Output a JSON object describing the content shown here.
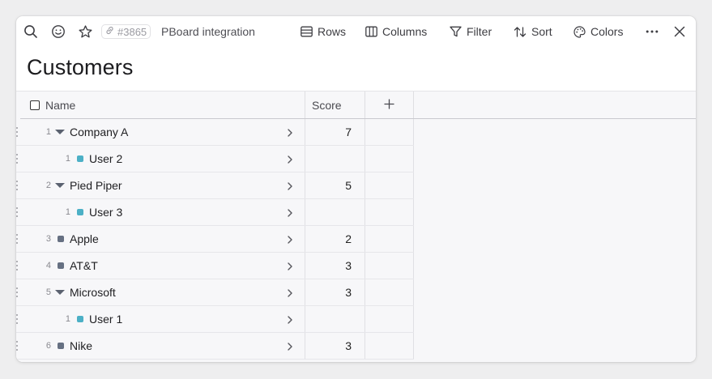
{
  "toolbar": {
    "icons": [
      "search-icon",
      "emoji-icon",
      "star-icon",
      "link-icon",
      "more-icon",
      "close-icon"
    ],
    "ref_id": "#3865",
    "ref_title": "PBoard integration",
    "rows_label": "Rows",
    "columns_label": "Columns",
    "filter_label": "Filter",
    "sort_label": "Sort",
    "colors_label": "Colors"
  },
  "page": {
    "title": "Customers"
  },
  "table": {
    "columns": {
      "name": "Name",
      "score": "Score",
      "add": "+"
    },
    "colors": {
      "group_marker": "#5b6270",
      "item_marker": "#667082",
      "child_marker": "#4cb0c6"
    },
    "rows": [
      {
        "num": "1",
        "label": "Company A",
        "score": "7",
        "level": 0,
        "kind": "group"
      },
      {
        "num": "1",
        "label": "User 2",
        "score": "",
        "level": 1,
        "kind": "child"
      },
      {
        "num": "2",
        "label": "Pied Piper",
        "score": "5",
        "level": 0,
        "kind": "group"
      },
      {
        "num": "1",
        "label": "User 3",
        "score": "",
        "level": 1,
        "kind": "child"
      },
      {
        "num": "3",
        "label": "Apple",
        "score": "2",
        "level": 0,
        "kind": "item"
      },
      {
        "num": "4",
        "label": "AT&T",
        "score": "3",
        "level": 0,
        "kind": "item"
      },
      {
        "num": "5",
        "label": "Microsoft",
        "score": "3",
        "level": 0,
        "kind": "group"
      },
      {
        "num": "1",
        "label": "User 1",
        "score": "",
        "level": 1,
        "kind": "child"
      },
      {
        "num": "6",
        "label": "Nike",
        "score": "3",
        "level": 0,
        "kind": "item"
      }
    ]
  }
}
